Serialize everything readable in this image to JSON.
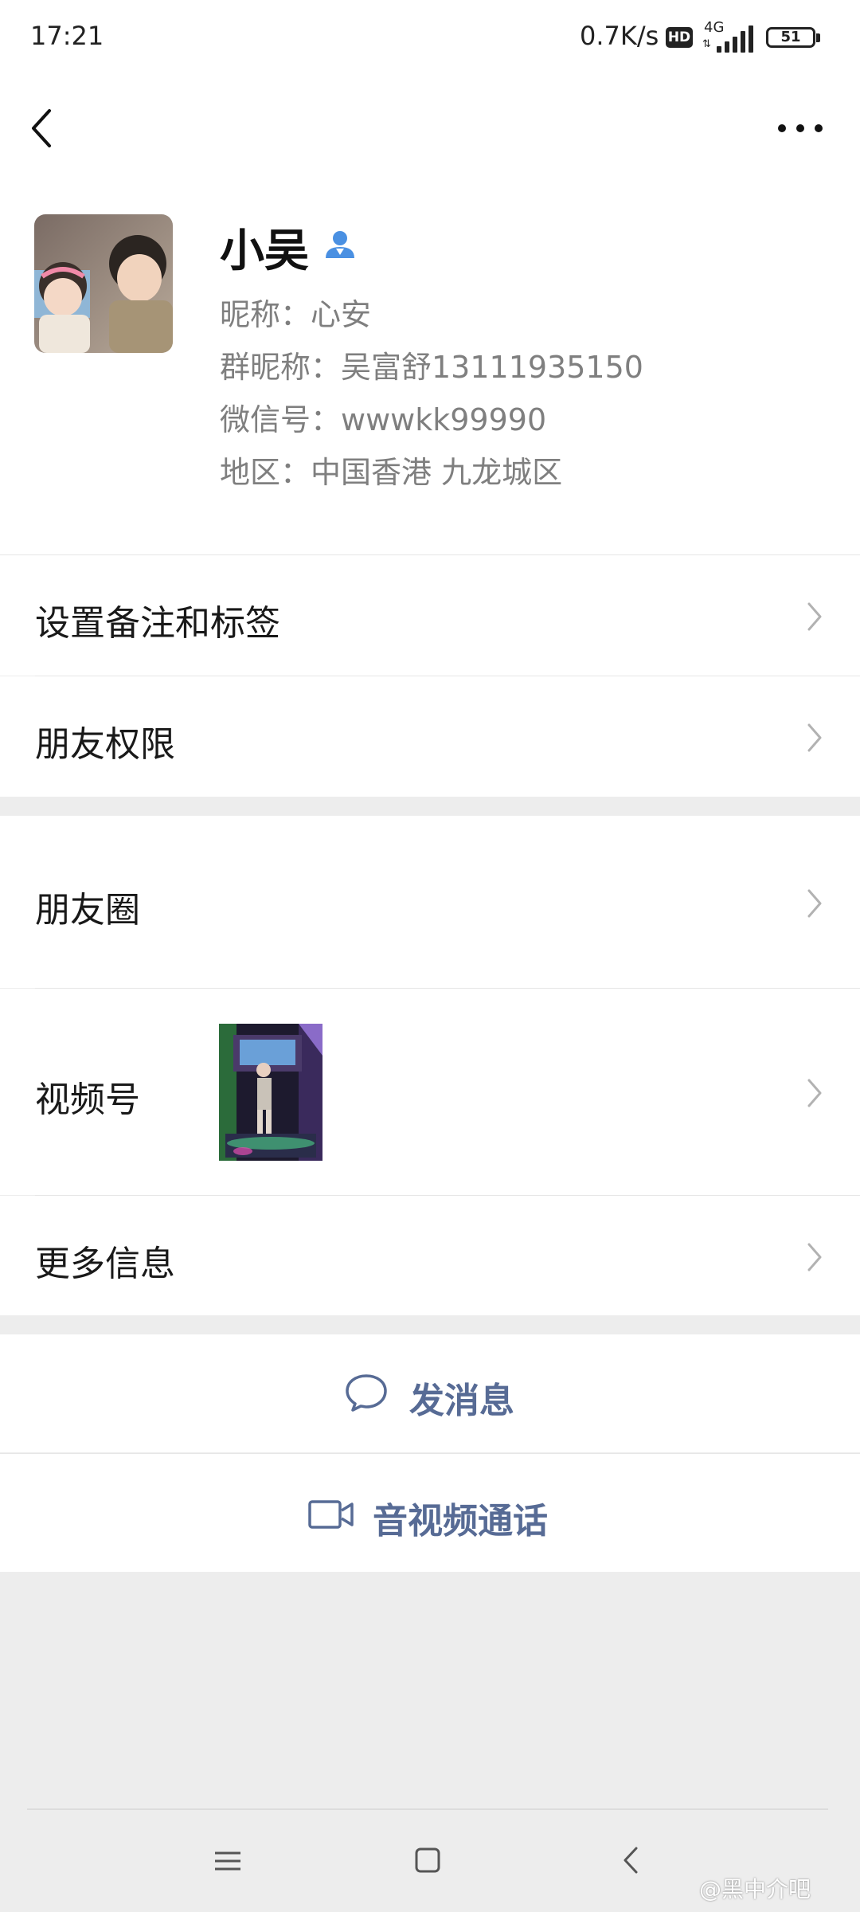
{
  "status_bar": {
    "time": "17:21",
    "speed": "0.7K/s",
    "hd": "HD",
    "network": "4G",
    "battery": "51"
  },
  "nav": {
    "back_icon": "chevron-left-icon",
    "more_icon": "more-dots-icon"
  },
  "profile": {
    "name": "小吴",
    "nickname": "昵称：心安",
    "group_nickname": "群昵称：吴富舒13111935150",
    "wechat_id": "微信号：wwwkk99990",
    "region": "地区：中国香港  九龙城区"
  },
  "menu": {
    "remark": "设置备注和标签",
    "permission": "朋友权限",
    "moments": "朋友圈",
    "channels": "视频号",
    "more_info": "更多信息"
  },
  "actions": {
    "message": "发消息",
    "call": "音视频通话"
  },
  "watermark": "@黑中介吧",
  "colors": {
    "accent": "#576b95",
    "page_bg": "#ededed",
    "verified": "#4a90e2"
  }
}
